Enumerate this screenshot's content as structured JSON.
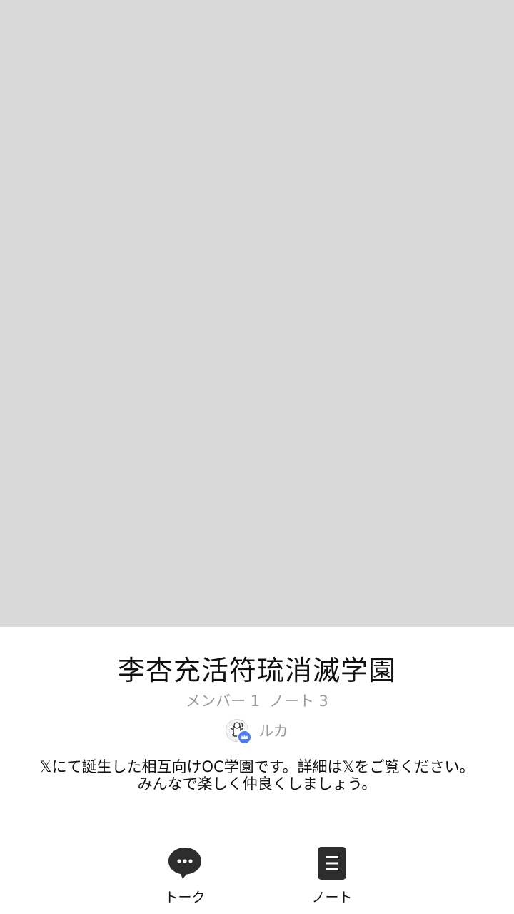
{
  "cover": {},
  "room": {
    "title": "李杏充活符琉消滅学園",
    "members_label": "メンバー 1",
    "notes_label": "ノート 3"
  },
  "owner": {
    "name": "ルカ",
    "avatar_icon": "character-avatar-icon",
    "badge_icon": "crown-badge-icon",
    "badge_color": "#4c7cf3"
  },
  "description": {
    "line1": "𝕏にて誕生した相互向けOC学園です。詳細は𝕏をご覧ください。",
    "line2": "みんなで楽しく仲良くしましょう。"
  },
  "nav": {
    "talk_label": "トーク",
    "talk_icon": "chat-bubble-icon",
    "note_label": "ノート",
    "note_icon": "note-icon"
  }
}
